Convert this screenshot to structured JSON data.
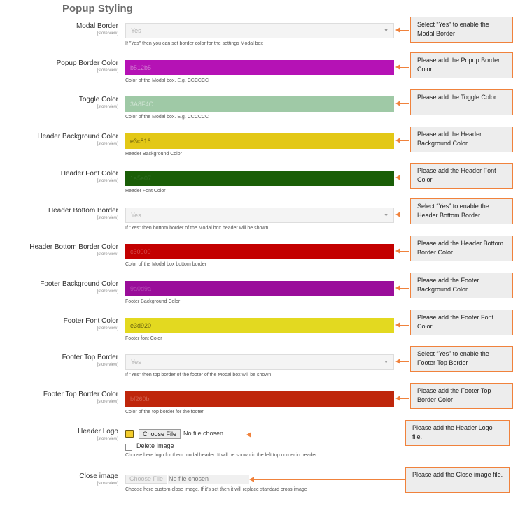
{
  "page_title": "Popup Styling",
  "scope_label": "[store view]",
  "rows": [
    {
      "label": "Modal Border",
      "type": "select",
      "value": "Yes",
      "note": "If \"Yes\" then you can set border color for the settings Modal box",
      "callout": "Select “Yes” to enable the Modal Border"
    },
    {
      "label": "Popup Border Color",
      "type": "color",
      "value": "b512b5",
      "bg": "#b512b5",
      "fg": "#d27bd2",
      "note": "Color of the Modal box. E.g. CCCCCC",
      "callout": "Please add the Popup Border Color"
    },
    {
      "label": "Toggle Color",
      "type": "color",
      "value": "3A8F4C",
      "bg": "#9fc9a6",
      "fg": "#cfe3d3",
      "note": "Color of the Modal box. E.g. CCCCCC",
      "callout": "Please add the Toggle Color"
    },
    {
      "label": "Header Background Color",
      "type": "color",
      "value": "e3c816",
      "bg": "#e3c816",
      "fg": "#6b5e0a",
      "note": "Header Background Color",
      "callout": "Please add the Header Background Color"
    },
    {
      "label": "Header Font Color",
      "type": "color",
      "value": "1a5e07",
      "bg": "#1a5e07",
      "fg": "#2f6d22",
      "note": "Header Font Color",
      "callout": "Please add the Header Font Color"
    },
    {
      "label": "Header Bottom Border",
      "type": "select",
      "value": "Yes",
      "note": "If \"Yes\" then bottom border of the Modal box header will be shown",
      "callout": "Select “Yes” to enable the Header Bottom Border"
    },
    {
      "label": "Header Bottom Border Color",
      "type": "color",
      "value": "c30000",
      "bg": "#c30000",
      "fg": "#d24848",
      "note": "Color of the Modal box bottom border",
      "callout": "Please add the Header Bottom Border Color"
    },
    {
      "label": "Footer Background Color",
      "type": "color",
      "value": "9a0d9a",
      "bg": "#9a0d9a",
      "fg": "#b54cb5",
      "note": "Footer Background Color",
      "callout": "Please add the Footer Background Color"
    },
    {
      "label": "Footer Font Color",
      "type": "color",
      "value": "e3d920",
      "bg": "#e3d920",
      "fg": "#6a6512",
      "note": "Footer font Color",
      "callout": "Please add the Footer Font Color"
    },
    {
      "label": "Footer Top Border",
      "type": "select",
      "value": "Yes",
      "note": "If \"Yes\" then top border of the footer of the Modal box will be shown",
      "callout": "Select “Yes” to enable the Footer Top Border"
    },
    {
      "label": "Footer Top Border Color",
      "type": "color",
      "value": "bf260b",
      "bg": "#bf260b",
      "fg": "#d2614d",
      "note": "Color of the top border for the footer",
      "callout": "Please add the Footer Top Border Color"
    }
  ],
  "header_logo": {
    "label": "Header Logo",
    "choose_file": "Choose File",
    "no_file": "No file chosen",
    "delete_label": "Delete Image",
    "note": "Choose here logo for them modal header. It will be shown in the left top corner in header",
    "callout": "Please add the Header Logo file."
  },
  "close_image": {
    "label": "Close image",
    "choose_file": "Choose File",
    "no_file": "No file chosen",
    "note": "Choose here custom close image. If it's set then it will replace standard cross image",
    "callout": "Please add the Close image file."
  },
  "colors": {
    "accent_arrow": "#f0823c",
    "callout_bg": "#ededed"
  },
  "icons": {
    "select_arrow": "chevron-down-icon",
    "file_folder": "folder-icon",
    "arrow": "arrow-left-icon"
  }
}
